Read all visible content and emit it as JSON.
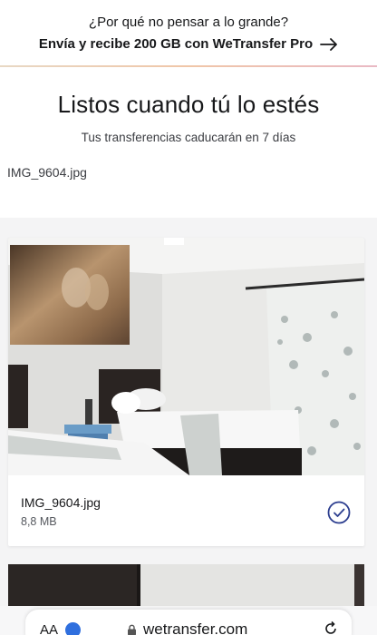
{
  "promo": {
    "question": "¿Por qué no pensar a lo grande?",
    "cta": "Envía y recibe 200 GB con WeTransfer Pro",
    "arrow_icon": "arrow-right-icon"
  },
  "header": {
    "title": "Listos cuando tú lo estés",
    "subtitle": "Tus transferencias caducarán en 7 días",
    "filename": "IMG_9604.jpg"
  },
  "files": [
    {
      "name": "IMG_9604.jpg",
      "size": "8,8 MB",
      "status_icon": "check-circle-icon"
    }
  ],
  "browser": {
    "text_size_label": "AA",
    "url": "wetransfer.com",
    "icons": [
      "lock-icon",
      "reload-icon",
      "extension-badge-icon"
    ]
  },
  "colors": {
    "accent": "#2c3e8f",
    "promo_line": "#f0c6a8"
  }
}
